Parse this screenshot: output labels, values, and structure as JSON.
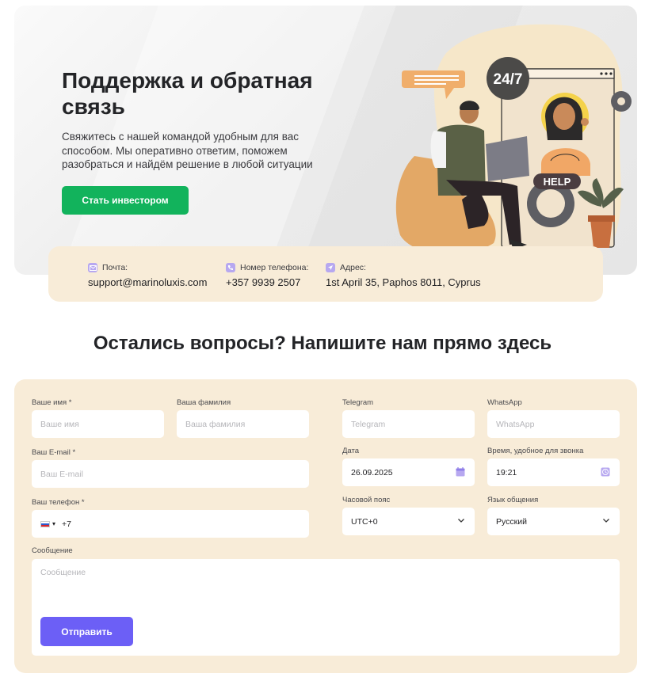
{
  "hero": {
    "title": "Поддержка и обратная связь",
    "description": "Свяжитесь с нашей командой удобным для вас способом. Мы оперативно ответим, поможем разобраться и найдём решение в любой ситуации",
    "cta_label": "Стать инвестором",
    "badge_247": "24/7",
    "help_label": "HELP"
  },
  "contacts": {
    "email_label": "Почта:",
    "email_value": "support@marinoluxis.com",
    "phone_label": "Номер телефона:",
    "phone_value": "+357 9939 2507",
    "address_label": "Адрес:",
    "address_value": "1st April 35, Paphos 8011, Cyprus"
  },
  "section_title": "Остались вопросы? Напишите нам прямо здесь",
  "form": {
    "first_name_label": "Ваше имя *",
    "first_name_placeholder": "Ваше имя",
    "last_name_label": "Ваша фамилия",
    "last_name_placeholder": "Ваша фамилия",
    "email_label": "Ваш E-mail *",
    "email_placeholder": "Ваш E-mail",
    "phone_label": "Ваш телефон *",
    "phone_prefix": "+7",
    "telegram_label": "Telegram",
    "telegram_placeholder": "Telegram",
    "whatsapp_label": "WhatsApp",
    "whatsapp_placeholder": "WhatsApp",
    "date_label": "Дата",
    "date_value": "26.09.2025",
    "time_label": "Время, удобное для звонка",
    "time_value": "19:21",
    "timezone_label": "Часовой пояс",
    "timezone_value": "UTC+0",
    "language_label": "Язык общения",
    "language_value": "Русский",
    "message_label": "Сообщение",
    "message_placeholder": "Сообщение",
    "submit_label": "Отправить"
  },
  "colors": {
    "accent_green": "#12b35c",
    "accent_purple": "#6c5ff6",
    "cream": "#f8ecd8"
  }
}
